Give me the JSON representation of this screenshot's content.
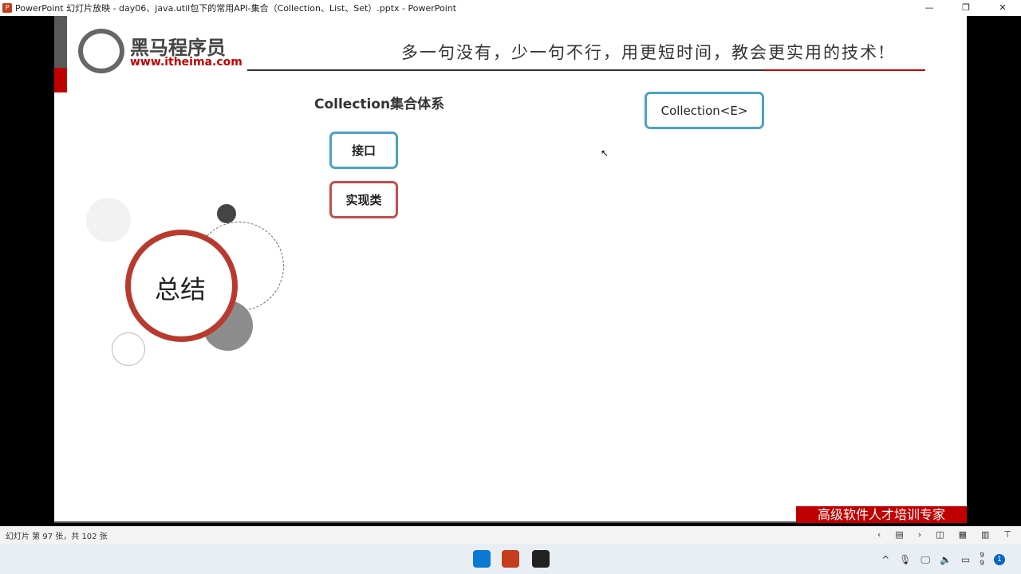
{
  "window": {
    "title": "PowerPoint 幻灯片放映  -  day06、java.util包下的常用API-集合（Collection、List、Set）.pptx - PowerPoint",
    "app_icon": "P"
  },
  "slide": {
    "brand": "黑马程序员",
    "url": "www.itheima.com",
    "slogan": "多一句没有，少一句不行，用更短时间，教会更实用的技术!",
    "heading": "Collection集合体系",
    "legend_interface": "接口",
    "legend_impl": "实现类",
    "root_node": "Collection<E>",
    "summary": "总结",
    "footer": "高级软件人才培训专家"
  },
  "status": {
    "slide_info": "幻灯片 第 97 张，共 102 张"
  },
  "tray": {
    "notifications": "1",
    "clock": "9\n9"
  }
}
